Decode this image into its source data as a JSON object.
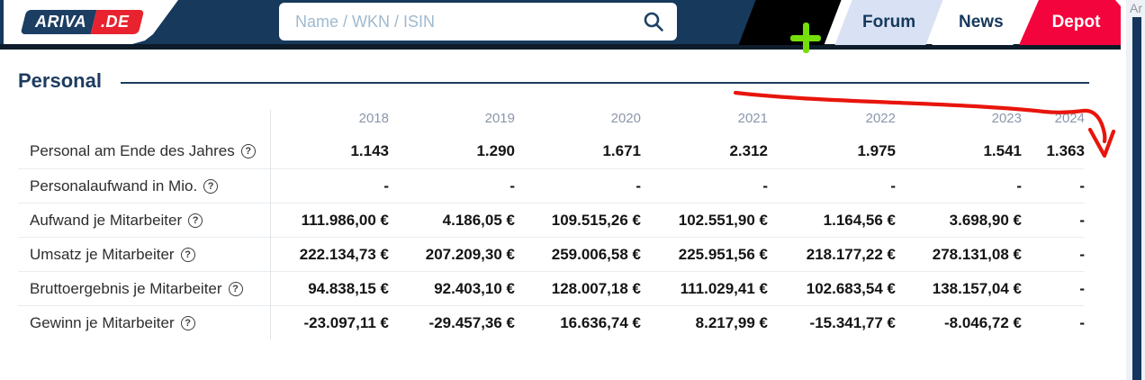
{
  "header": {
    "logo": {
      "brand": "ARIVA",
      "tld": ".DE"
    },
    "search": {
      "placeholder": "Name / WKN / ISIN",
      "value": ""
    },
    "tabs": [
      {
        "label": "Forum"
      },
      {
        "label": "News"
      },
      {
        "label": "Depot"
      }
    ]
  },
  "side_panel": {
    "clipped_text": "Ar"
  },
  "page": {
    "section_title": "Personal"
  },
  "table": {
    "years": [
      "2018",
      "2019",
      "2020",
      "2021",
      "2022",
      "2023",
      "2024"
    ],
    "rows": [
      {
        "label": "Personal am Ende des Jahres",
        "values": [
          "1.143",
          "1.290",
          "1.671",
          "2.312",
          "1.975",
          "1.541",
          "1.363"
        ]
      },
      {
        "label": "Personalaufwand in Mio.",
        "values": [
          "-",
          "-",
          "-",
          "-",
          "-",
          "-",
          "-"
        ]
      },
      {
        "label": "Aufwand je Mitarbeiter",
        "values": [
          "111.986,00 €",
          "4.186,05 €",
          "109.515,26 €",
          "102.551,90 €",
          "1.164,56 €",
          "3.698,90 €",
          "-"
        ]
      },
      {
        "label": "Umsatz je Mitarbeiter",
        "values": [
          "222.134,73 €",
          "207.209,30 €",
          "259.006,58 €",
          "225.951,56 €",
          "218.177,22 €",
          "278.131,08 €",
          "-"
        ]
      },
      {
        "label": "Bruttoergebnis je Mitarbeiter",
        "values": [
          "94.838,15 €",
          "92.403,10 €",
          "128.007,18 €",
          "111.029,41 €",
          "102.683,54 €",
          "138.157,04 €",
          "-"
        ]
      },
      {
        "label": "Gewinn je Mitarbeiter",
        "values": [
          "-23.097,11 €",
          "-29.457,36 €",
          "16.636,74 €",
          "8.217,99 €",
          "-15.341,77 €",
          "-8.046,72 €",
          "-"
        ]
      }
    ]
  },
  "icons": {
    "help_glyph": "?"
  },
  "annotation": {
    "type": "hand-drawn-arrow",
    "color": "#e8150c"
  },
  "colors": {
    "header_navy": "#16395c",
    "header_strip": "#0d1b2a",
    "logo_navy": "#1c3e63",
    "logo_red": "#e8232f",
    "plus_green": "#76df0a",
    "tab_forum_bg": "#d9e2f4",
    "tab_depot_bg": "#f3043c",
    "section_navy": "#1e3c60",
    "year_label_grey": "#8b96aa",
    "side_bar_navy": "#14355d"
  }
}
